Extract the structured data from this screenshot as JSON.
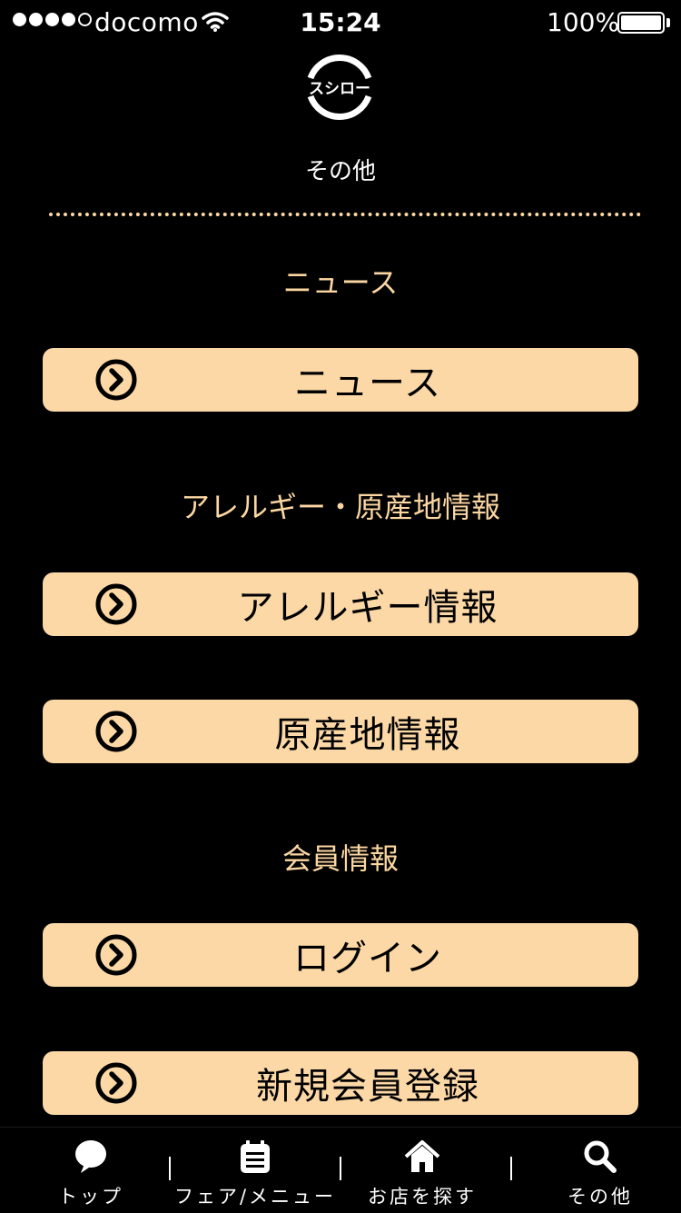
{
  "status_bar": {
    "carrier": "docomo",
    "time": "15:24",
    "battery_percent": "100%",
    "battery_level": 1.0,
    "signal_bars": 4,
    "signal_max": 5
  },
  "header": {
    "logo_text": "スシロー",
    "title": "その他"
  },
  "sections": {
    "news": {
      "heading": "ニュース",
      "buttons": [
        "ニュース"
      ]
    },
    "allergy": {
      "heading": "アレルギー・原産地情報",
      "buttons": [
        "アレルギー情報",
        "原産地情報"
      ]
    },
    "member": {
      "heading": "会員情報",
      "buttons": [
        "ログイン",
        "新規会員登録"
      ]
    }
  },
  "tab_bar": {
    "tabs": [
      {
        "label": "トップ",
        "icon": "speech-bubble-icon"
      },
      {
        "label": "フェア/メニュー",
        "icon": "menu-list-icon"
      },
      {
        "label": "お店を探す",
        "icon": "home-icon"
      },
      {
        "label": "その他",
        "icon": "search-icon"
      }
    ]
  },
  "colors": {
    "background": "#000000",
    "button": "#fcd8a6",
    "heading": "#fbd6a2"
  }
}
